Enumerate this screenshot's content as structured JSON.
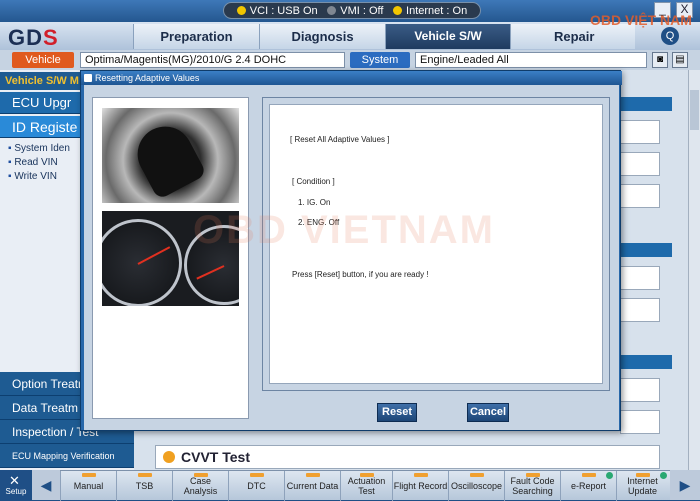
{
  "titlebar": {
    "vci": "VCI : USB On",
    "vmi": "VMI : Off",
    "internet": "Internet : On",
    "minimize": "_",
    "close": "X"
  },
  "brand": {
    "logo_left": "GD",
    "logo_right": "S",
    "watermark": "OBD VIỆT NAM"
  },
  "nav": {
    "tabs": [
      "Preparation",
      "Diagnosis",
      "Vehicle S/W Management",
      "Repair"
    ],
    "active_index": 2,
    "help": "Q"
  },
  "vehicle_bar": {
    "vehicle_label": "Vehicle",
    "vehicle_value": "Optima/Magentis(MG)/2010/G 2.4 DOHC",
    "system_label": "System",
    "system_value": "Engine/Leaded All"
  },
  "left_panel": {
    "title": "Vehicle S/W M",
    "items": [
      "ECU Upgr",
      "ID Registe"
    ],
    "sub_items": [
      "System Iden",
      "Read VIN",
      "Write VIN"
    ],
    "bottom_items": [
      "Option Treatm",
      "Data Treatm",
      "Inspection / Test",
      "ECU Mapping Verification"
    ]
  },
  "right_panel": {
    "cvvt_title": "CVVT Test"
  },
  "modal": {
    "title": "Resetting Adaptive Values",
    "header_text": "[ Reset All Adaptive Values ]",
    "condition_title": "[ Condition ]",
    "conditions": [
      "1. IG. On",
      "2. ENG. Off"
    ],
    "instruction": "Press [Reset] button, if you are ready !",
    "reset_label": "Reset",
    "cancel_label": "Cancel",
    "watermark": "OBD VIETNAM"
  },
  "toolbar": {
    "setup": "Setup",
    "items": [
      "Manual",
      "TSB",
      "Case Analysis",
      "DTC",
      "Current Data",
      "Actuation Test",
      "Flight Record",
      "Oscilloscope",
      "Fault Code Searching",
      "e-Report",
      "Internet Update"
    ]
  },
  "colors": {
    "accent": "#1f4f86",
    "active_tab": "#1f3b60",
    "vehicle_btn": "#e05a1e",
    "system_btn": "#2b6cc0"
  }
}
